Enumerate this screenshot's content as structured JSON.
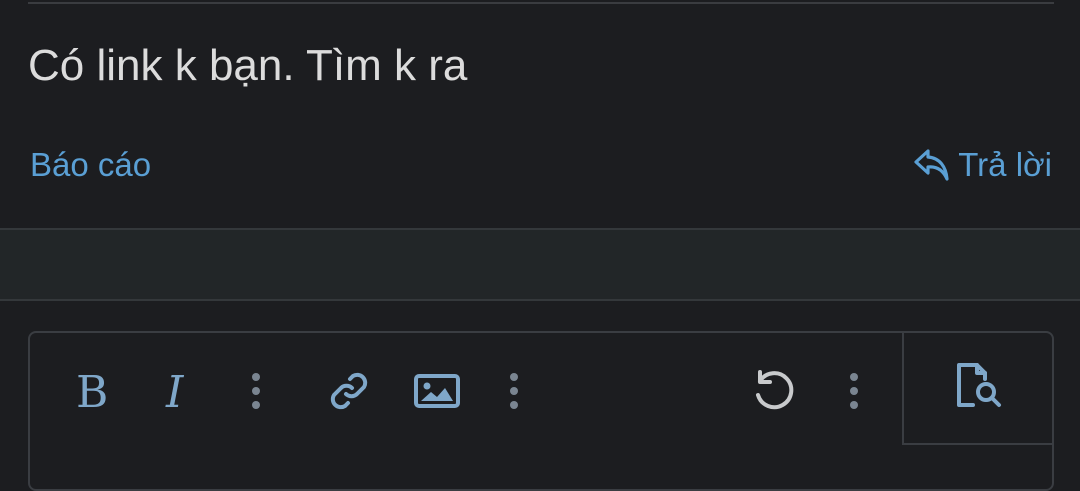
{
  "post": {
    "body_text": "Có link k bạn. Tìm k ra",
    "report_label": "Báo cáo",
    "reply_label": "Trả lời"
  },
  "editor": {
    "toolbar": [
      {
        "name": "bold",
        "icon": "bold-icon"
      },
      {
        "name": "italic",
        "icon": "italic-icon"
      },
      {
        "name": "more-text",
        "icon": "more-vertical-icon"
      },
      {
        "name": "link",
        "icon": "link-icon"
      },
      {
        "name": "image",
        "icon": "image-icon"
      },
      {
        "name": "more-insert",
        "icon": "more-vertical-icon"
      },
      {
        "name": "undo",
        "icon": "undo-icon"
      },
      {
        "name": "more-options",
        "icon": "more-vertical-icon"
      },
      {
        "name": "preview",
        "icon": "preview-icon"
      }
    ]
  },
  "colors": {
    "background": "#1c1d20",
    "text": "#dcdcdc",
    "link": "#5a9fd4",
    "icon": "#7fa7c9",
    "muted_icon": "#8a96a3"
  }
}
